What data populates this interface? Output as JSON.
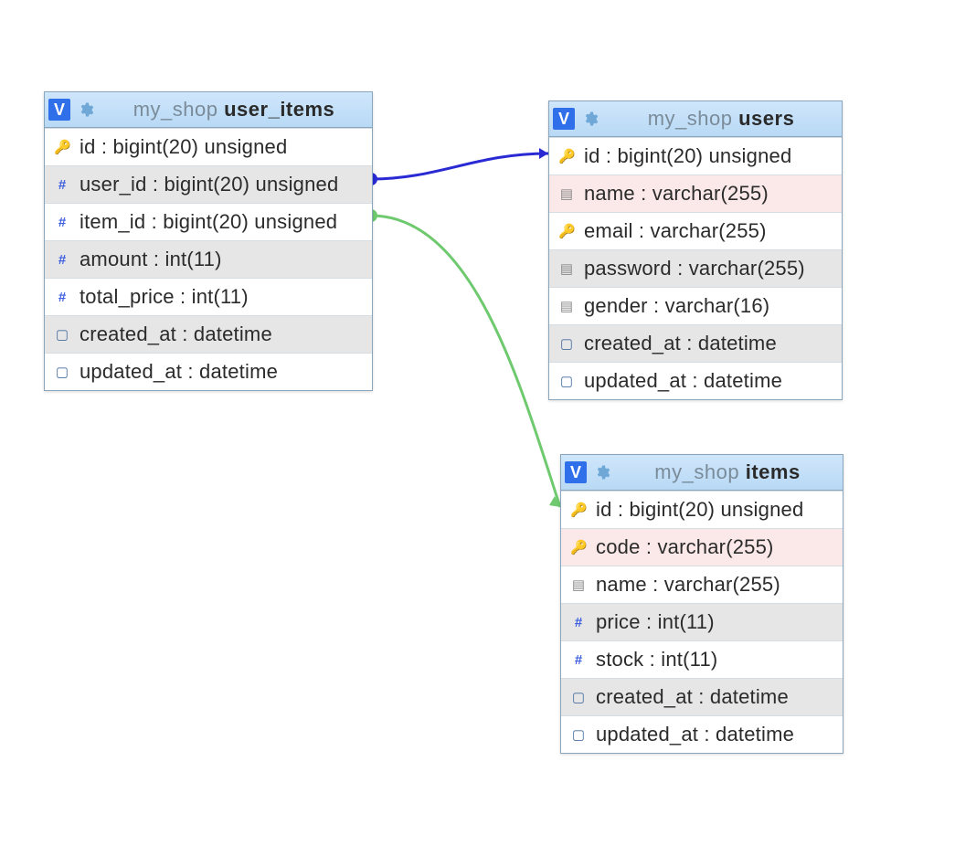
{
  "tables": {
    "user_items": {
      "schema": "my_shop",
      "name": "user_items",
      "columns": [
        {
          "icon": "key",
          "text": "id : bigint(20) unsigned"
        },
        {
          "icon": "hash",
          "text": "user_id : bigint(20) unsigned"
        },
        {
          "icon": "hash",
          "text": "item_id : bigint(20) unsigned"
        },
        {
          "icon": "hash",
          "text": "amount : int(11)"
        },
        {
          "icon": "hash",
          "text": "total_price : int(11)"
        },
        {
          "icon": "date",
          "text": "created_at : datetime"
        },
        {
          "icon": "date",
          "text": "updated_at : datetime"
        }
      ]
    },
    "users": {
      "schema": "my_shop",
      "name": "users",
      "columns": [
        {
          "icon": "key",
          "text": "id : bigint(20) unsigned"
        },
        {
          "icon": "text",
          "text": "name : varchar(255)",
          "pink": true
        },
        {
          "icon": "key",
          "text": "email : varchar(255)"
        },
        {
          "icon": "text",
          "text": "password : varchar(255)"
        },
        {
          "icon": "text",
          "text": "gender : varchar(16)"
        },
        {
          "icon": "date",
          "text": "created_at : datetime"
        },
        {
          "icon": "date",
          "text": "updated_at : datetime"
        }
      ]
    },
    "items": {
      "schema": "my_shop",
      "name": "items",
      "columns": [
        {
          "icon": "key",
          "text": "id : bigint(20) unsigned"
        },
        {
          "icon": "key",
          "text": "code : varchar(255)",
          "pink": true
        },
        {
          "icon": "text",
          "text": "name : varchar(255)"
        },
        {
          "icon": "hash",
          "text": "price : int(11)"
        },
        {
          "icon": "hash",
          "text": "stock : int(11)"
        },
        {
          "icon": "date",
          "text": "created_at : datetime"
        },
        {
          "icon": "date",
          "text": "updated_at : datetime"
        }
      ]
    }
  },
  "relations": [
    {
      "from": "user_items.user_id",
      "to": "users.id",
      "color": "#2a2ad4"
    },
    {
      "from": "user_items.item_id",
      "to": "items.id",
      "color": "#6fc96f"
    }
  ]
}
